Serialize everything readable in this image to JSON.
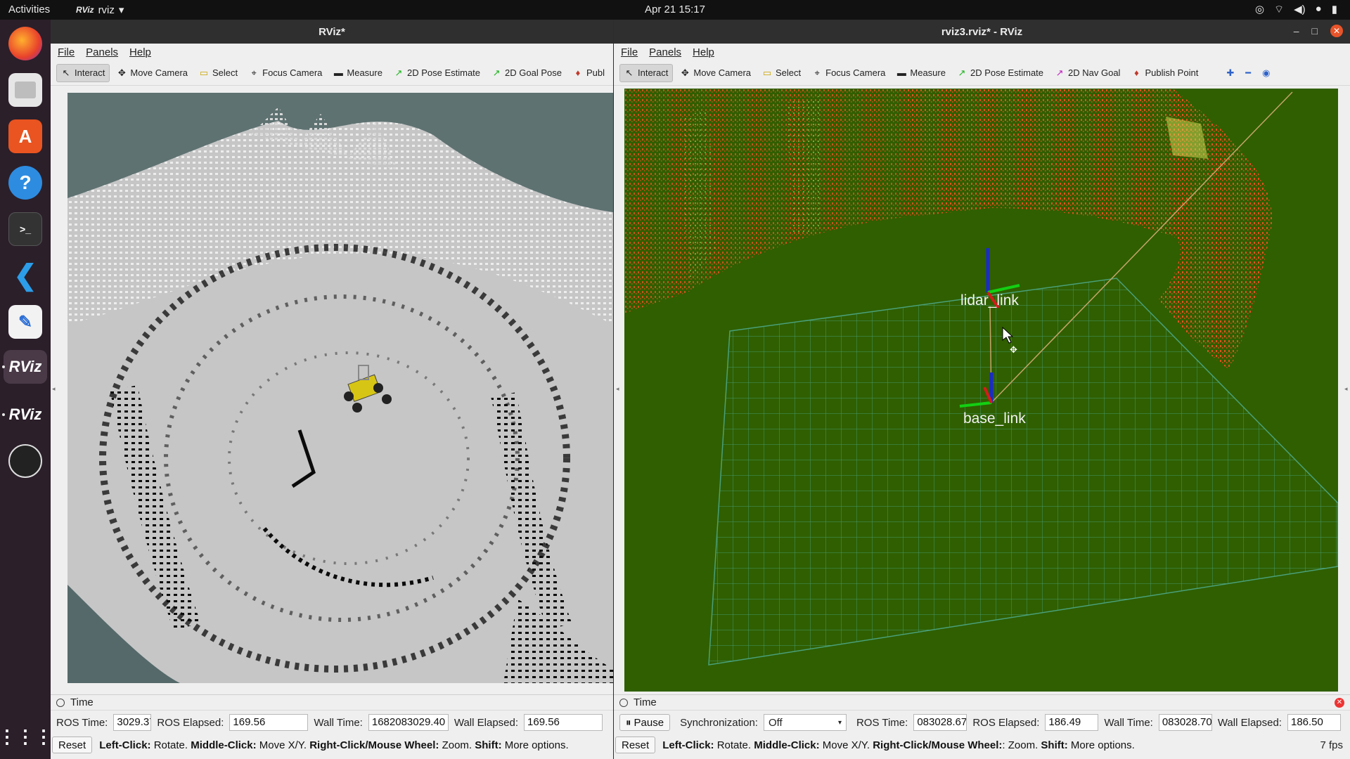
{
  "topbar": {
    "activities": "Activities",
    "app_menu": "rviz",
    "app_menu_logo": "RViz",
    "clock": "Apr 21  15:17",
    "tray_icons": [
      "chrome-icon",
      "network-icon",
      "volume-icon",
      "mic-icon",
      "battery-icon"
    ]
  },
  "dock": {
    "items": [
      "firefox-icon",
      "files-icon",
      "app-center-icon",
      "help-icon",
      "terminal-icon",
      "vscode-icon",
      "text-editor-icon",
      "rviz-icon",
      "rviz-icon",
      "obs-icon",
      "show-apps-icon"
    ],
    "rviz_label": "RViz"
  },
  "left_window": {
    "title": "RViz*",
    "menu": [
      "File",
      "Panels",
      "Help"
    ],
    "tools": [
      "Interact",
      "Move Camera",
      "Select",
      "Focus Camera",
      "Measure",
      "2D Pose Estimate",
      "2D Goal Pose",
      "Publ"
    ],
    "time_panel": {
      "title": "Time",
      "ros_time_label": "ROS Time:",
      "ros_time": "3029.37",
      "ros_elapsed_label": "ROS Elapsed:",
      "ros_elapsed": "169.56",
      "wall_time_label": "Wall Time:",
      "wall_time": "1682083029.40",
      "wall_elapsed_label": "Wall Elapsed:",
      "wall_elapsed": "169.56"
    },
    "status": {
      "reset": "Reset",
      "lc": "Left-Click:",
      "lc_t": "Rotate.",
      "mc": "Middle-Click:",
      "mc_t": "Move X/Y.",
      "rc": "Right-Click/Mouse Wheel:",
      "rc_t": "Zoom.",
      "sh": "Shift:",
      "sh_t": "More options."
    }
  },
  "right_window": {
    "title": "rviz3.rviz* - RViz",
    "menu": [
      "File",
      "Panels",
      "Help"
    ],
    "tools": [
      "Interact",
      "Move Camera",
      "Select",
      "Focus Camera",
      "Measure",
      "2D Pose Estimate",
      "2D Nav Goal",
      "Publish Point"
    ],
    "viewport": {
      "frame_top": "lidar_link",
      "frame_bottom": "base_link",
      "background": "#2f5f00"
    },
    "time_panel": {
      "title": "Time",
      "pause": "Pause",
      "sync_label": "Synchronization:",
      "sync_value": "Off",
      "ros_time_label": "ROS Time:",
      "ros_time": "083028.67",
      "ros_elapsed_label": "ROS Elapsed:",
      "ros_elapsed": "186.49",
      "wall_time_label": "Wall Time:",
      "wall_time": "083028.70",
      "wall_elapsed_label": "Wall Elapsed:",
      "wall_elapsed": "186.50"
    },
    "status": {
      "reset": "Reset",
      "lc": "Left-Click:",
      "lc_t": "Rotate.",
      "mc": "Middle-Click:",
      "mc_t": "Move X/Y.",
      "rc": "Right-Click/Mouse Wheel:",
      "rc_t": ": Zoom.",
      "sh": "Shift:",
      "sh_t": "More options.",
      "fps": "7 fps"
    }
  }
}
